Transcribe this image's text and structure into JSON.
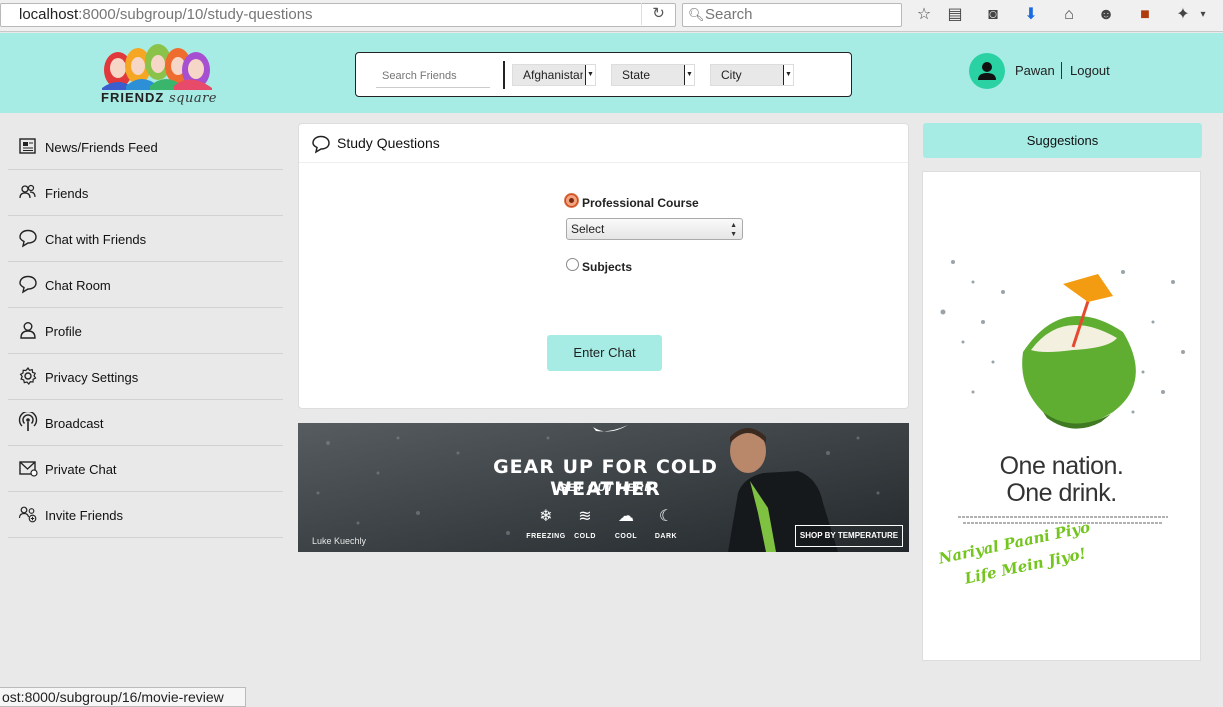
{
  "browser": {
    "url_host": "localhost",
    "url_path": ":8000/subgroup/10/study-questions",
    "search_placeholder": "Search",
    "status_url": "ost:8000/subgroup/16/movie-review"
  },
  "header": {
    "logo_word": "FRIENDZ",
    "logo_script": "square",
    "search_friends_placeholder": "Search Friends",
    "country": "Afghanistan",
    "state": "State",
    "city": "City",
    "user_name": "Pawan",
    "logout_label": "Logout"
  },
  "sidebar": {
    "items": [
      {
        "label": "News/Friends Feed",
        "icon": "newspaper-icon"
      },
      {
        "label": "Friends",
        "icon": "friends-icon"
      },
      {
        "label": "Chat with Friends",
        "icon": "chat-bubble-icon"
      },
      {
        "label": "Chat Room",
        "icon": "chat-bubble-icon"
      },
      {
        "label": "Profile",
        "icon": "user-icon"
      },
      {
        "label": "Privacy Settings",
        "icon": "gear-icon"
      },
      {
        "label": "Broadcast",
        "icon": "broadcast-icon"
      },
      {
        "label": "Private Chat",
        "icon": "mail-icon"
      },
      {
        "label": "Invite Friends",
        "icon": "invite-icon"
      }
    ]
  },
  "main": {
    "title": "Study Questions",
    "option_course": "Professional Course",
    "course_select_value": "Select",
    "option_subjects": "Subjects",
    "enter_chat_label": "Enter Chat"
  },
  "banner": {
    "headline": "GEAR UP FOR COLD WEATHER",
    "subline": "GET OUT HERE",
    "weather": [
      "FREEZING",
      "COLD",
      "COOL",
      "DARK"
    ],
    "shop_label": "SHOP BY TEMPERATURE",
    "credit": "Luke Kuechly"
  },
  "right": {
    "suggestions_title": "Suggestions",
    "ad_line1": "One nation.",
    "ad_line2": "One drink.",
    "ad_tag1": "Nariyal Paani Piyo",
    "ad_tag2": "Life Mein Jiyo!"
  },
  "colors": {
    "accent": "#a6ece4",
    "avatar": "#2ad1a3"
  }
}
